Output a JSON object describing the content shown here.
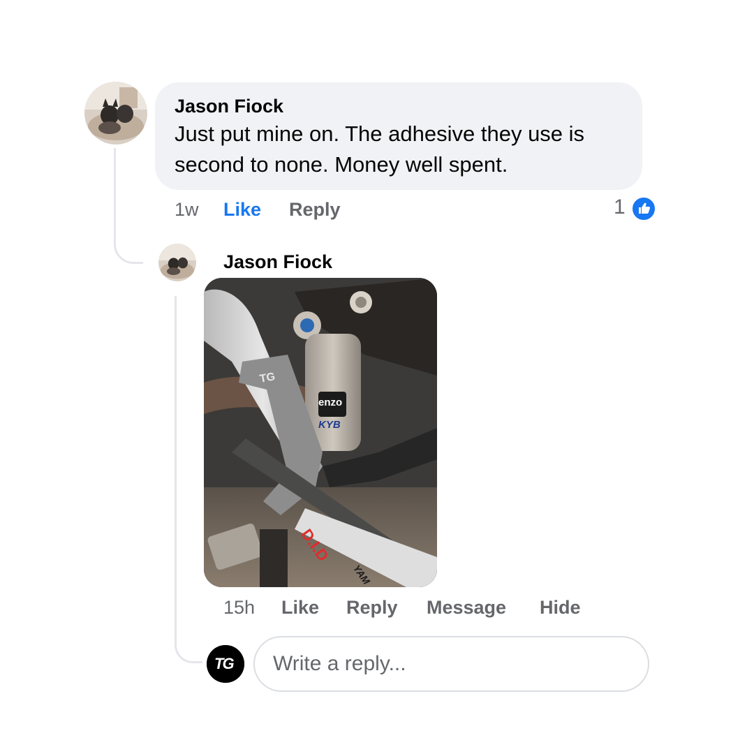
{
  "comment": {
    "author": "Jason Fiock",
    "text": "Just put mine on. The adhesive they use is second to none. Money well spent.",
    "time": "1w",
    "like_label": "Like",
    "reply_label": "Reply",
    "reaction_count": "1",
    "reaction_icon": "thumbs-up-icon"
  },
  "reply": {
    "author": "Jason Fiock",
    "image_description": "photo",
    "photo_text": {
      "grip_logo": "TG",
      "shock_brand_1": "enzo",
      "shock_brand_2": "KYB",
      "chain_brand": "D.I.D",
      "swingarm_text": "YAM"
    },
    "time": "15h",
    "like_label": "Like",
    "reply_label": "Reply",
    "message_label": "Message",
    "hide_label": "Hide"
  },
  "reply_box": {
    "placeholder": "Write a reply...",
    "avatar_logo": "TG"
  },
  "colors": {
    "accent": "#1877f2",
    "bubble": "#f0f2f5",
    "secondary_text": "#65676b",
    "thread_line": "#e4e6eb"
  }
}
